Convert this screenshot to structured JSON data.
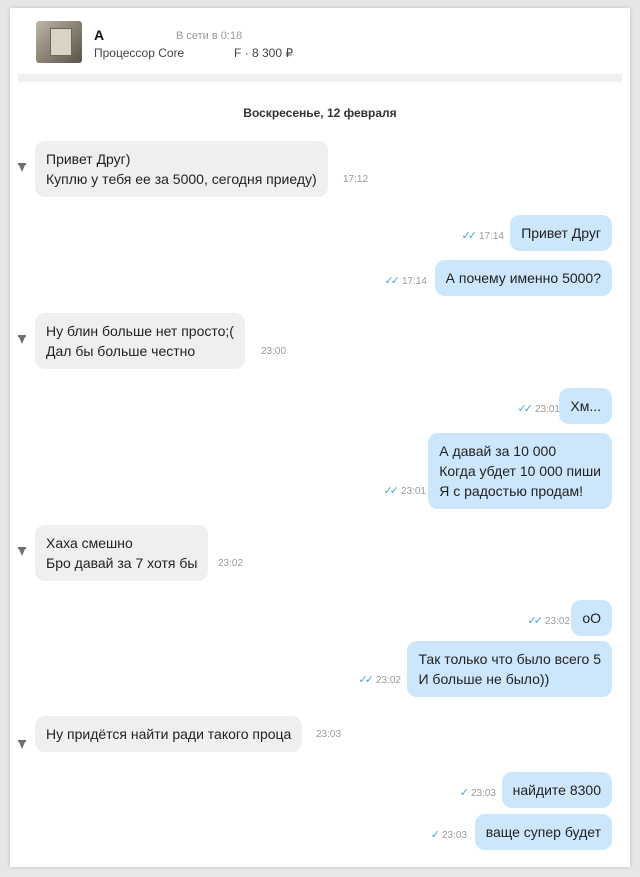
{
  "header": {
    "name": "А",
    "status": "В сети в 0:18",
    "product": "Процессор Core",
    "price": "F · 8 300 ₽"
  },
  "date": "Воскресенье, 12 февраля",
  "colors": {
    "incoming": "#efefef",
    "outgoing": "#cce6fb",
    "ticks": "#4aa3df"
  },
  "messages": [
    {
      "line1": "Привет  Друг)",
      "line2": "Куплю у тебя ее за 5000, сегодня приеду)",
      "time": "17:12"
    },
    {
      "line1": "Привет Друг",
      "time": "17:14",
      "ticks": "✓✓"
    },
    {
      "line1": "А почему именно 5000?",
      "time": "17:14",
      "ticks": "✓✓"
    },
    {
      "line1": "Ну блин больше нет просто;(",
      "line2": "Дал бы больше честно",
      "time": "23:00"
    },
    {
      "line1": "Хм...",
      "time": "23:01",
      "ticks": "✓✓"
    },
    {
      "line1": "А давай за 10 000",
      "line2": "Когда убдет 10 000 пиши",
      "line3": "Я с радостью продам!",
      "time": "23:01",
      "ticks": "✓✓"
    },
    {
      "line1": "Хаха смешно",
      "line2": "Бро давай за 7 хотя бы",
      "time": "23:02"
    },
    {
      "line1": "оО",
      "time": "23:02",
      "ticks": "✓✓"
    },
    {
      "line1": "Так только что было всего 5",
      "line2": "И больше не было))",
      "time": "23:02",
      "ticks": "✓✓"
    },
    {
      "line1": "Ну придётся найти ради такого проца",
      "time": "23:03"
    },
    {
      "line1": "найдите 8300",
      "time": "23:03",
      "ticks": "✓"
    },
    {
      "line1": "ваще супер будет",
      "time": "23:03",
      "ticks": "✓"
    }
  ]
}
